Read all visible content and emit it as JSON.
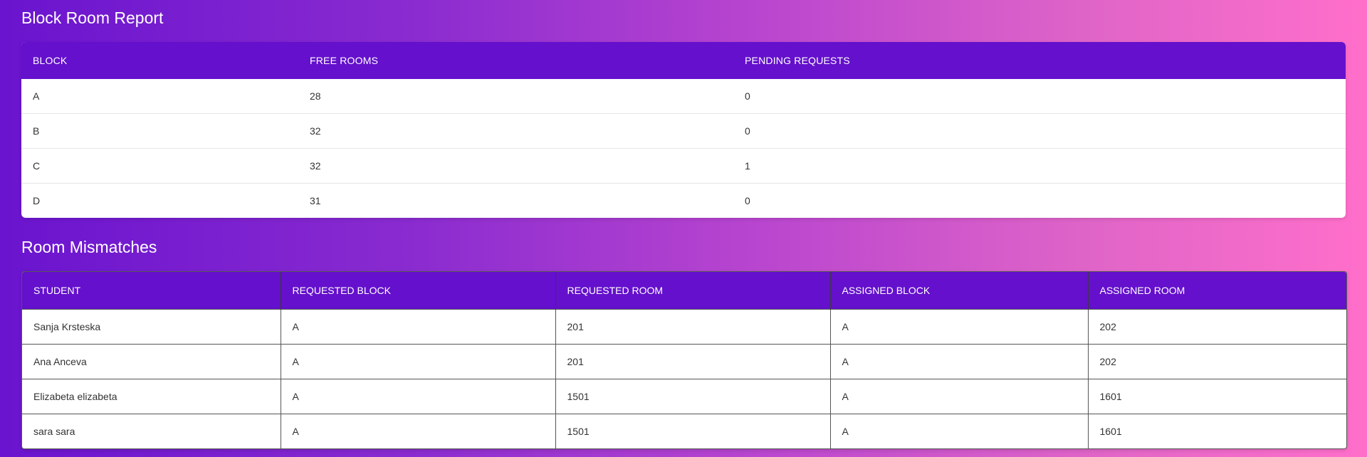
{
  "block_report": {
    "title": "Block Room Report",
    "headers": [
      "BLOCK",
      "FREE ROOMS",
      "PENDING REQUESTS"
    ],
    "rows": [
      [
        "A",
        "28",
        "0"
      ],
      [
        "B",
        "32",
        "0"
      ],
      [
        "C",
        "32",
        "1"
      ],
      [
        "D",
        "31",
        "0"
      ]
    ]
  },
  "mismatches": {
    "title": "Room Mismatches",
    "headers": [
      "STUDENT",
      "REQUESTED BLOCK",
      "REQUESTED ROOM",
      "ASSIGNED BLOCK",
      "ASSIGNED ROOM"
    ],
    "rows": [
      [
        "Sanja Krsteska",
        "A",
        "201",
        "A",
        "202"
      ],
      [
        "Ana Anceva",
        "A",
        "201",
        "A",
        "202"
      ],
      [
        "Elizabeta elizabeta",
        "A",
        "1501",
        "A",
        "1601"
      ],
      [
        "sara sara",
        "A",
        "1501",
        "A",
        "1601"
      ]
    ]
  },
  "colors": {
    "header_bg": "#6410cc",
    "gradient_start": "#6a14cf",
    "gradient_end": "#ff6fca"
  }
}
